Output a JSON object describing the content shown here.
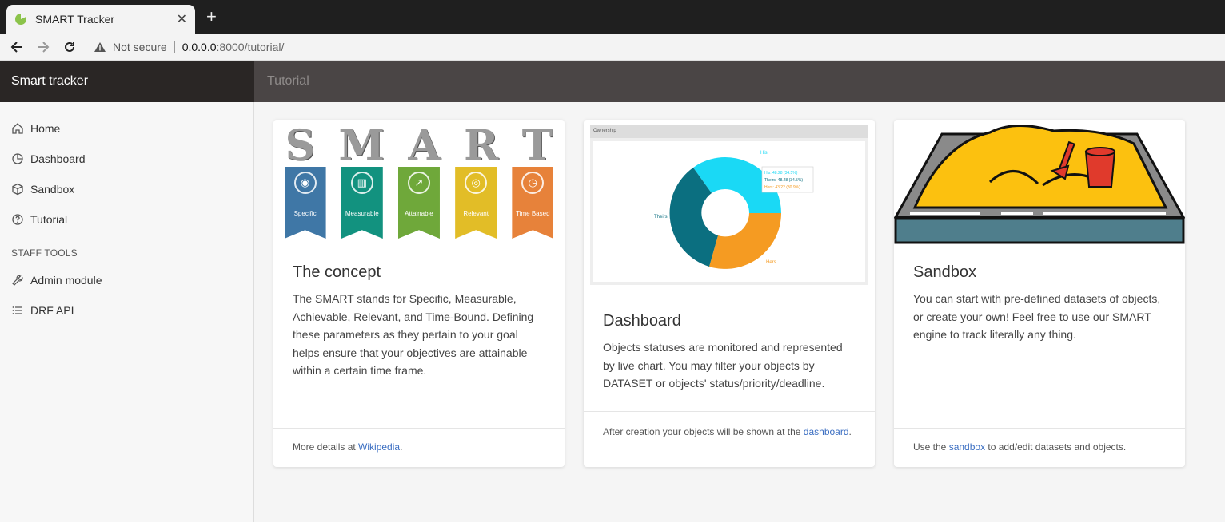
{
  "browser": {
    "tab_title": "SMART Tracker",
    "security_label": "Not secure",
    "url_host": "0.0.0.0",
    "url_path": ":8000/tutorial/"
  },
  "app": {
    "brand": "Smart tracker",
    "page_title": "Tutorial"
  },
  "sidebar": {
    "items": [
      {
        "label": "Home",
        "icon": "home-icon"
      },
      {
        "label": "Dashboard",
        "icon": "pie-chart-icon"
      },
      {
        "label": "Sandbox",
        "icon": "box-icon"
      },
      {
        "label": "Tutorial",
        "icon": "help-circle-icon"
      }
    ],
    "staff_title": "STAFF TOOLS",
    "staff_items": [
      {
        "label": "Admin module",
        "icon": "wrench-icon"
      },
      {
        "label": "DRF API",
        "icon": "list-icon"
      }
    ]
  },
  "smart_image": {
    "letters": [
      "S",
      "M",
      "A",
      "R",
      "T"
    ],
    "ribbons": [
      {
        "label": "Specific",
        "color": "#3f77a6"
      },
      {
        "label": "Measurable",
        "color": "#12927f"
      },
      {
        "label": "Attainable",
        "color": "#6fa83a"
      },
      {
        "label": "Relevant",
        "color": "#e2bd27"
      },
      {
        "label": "Time Based",
        "color": "#e7823a"
      }
    ]
  },
  "dashboard_image": {
    "header": "Ownership",
    "legend": [
      "His: 48.28 (34.5%)",
      "Theirs: 48.28 (34.5%)",
      "Hers: 43.22 (30.9%)"
    ],
    "slice_labels": [
      "His",
      "Theirs",
      "Hers"
    ],
    "colors": [
      "#1ad9f5",
      "#0b6f80",
      "#f59b22"
    ]
  },
  "cards": [
    {
      "title": "The concept",
      "text": "The SMART stands for Specific, Measurable, Achievable, Relevant, and Time-Bound. Defining these parameters as they pertain to your goal helps ensure that your objectives are attainable within a certain time frame.",
      "footer_pre": "More details at ",
      "footer_link": "Wikipedia",
      "footer_post": "."
    },
    {
      "title": "Dashboard",
      "text": "Objects statuses are monitored and represented by live chart. You may filter your objects by DATASET or objects' status/priority/deadline.",
      "footer_pre": "After creation your objects will be shown at the ",
      "footer_link": "dashboard",
      "footer_post": "."
    },
    {
      "title": "Sandbox",
      "text": "You can start with pre-defined datasets of objects, or create your own! Feel free to use our SMART engine to track literally any thing.",
      "footer_pre": "Use the ",
      "footer_link": "sandbox",
      "footer_post": " to add/edit datasets and objects."
    }
  ]
}
